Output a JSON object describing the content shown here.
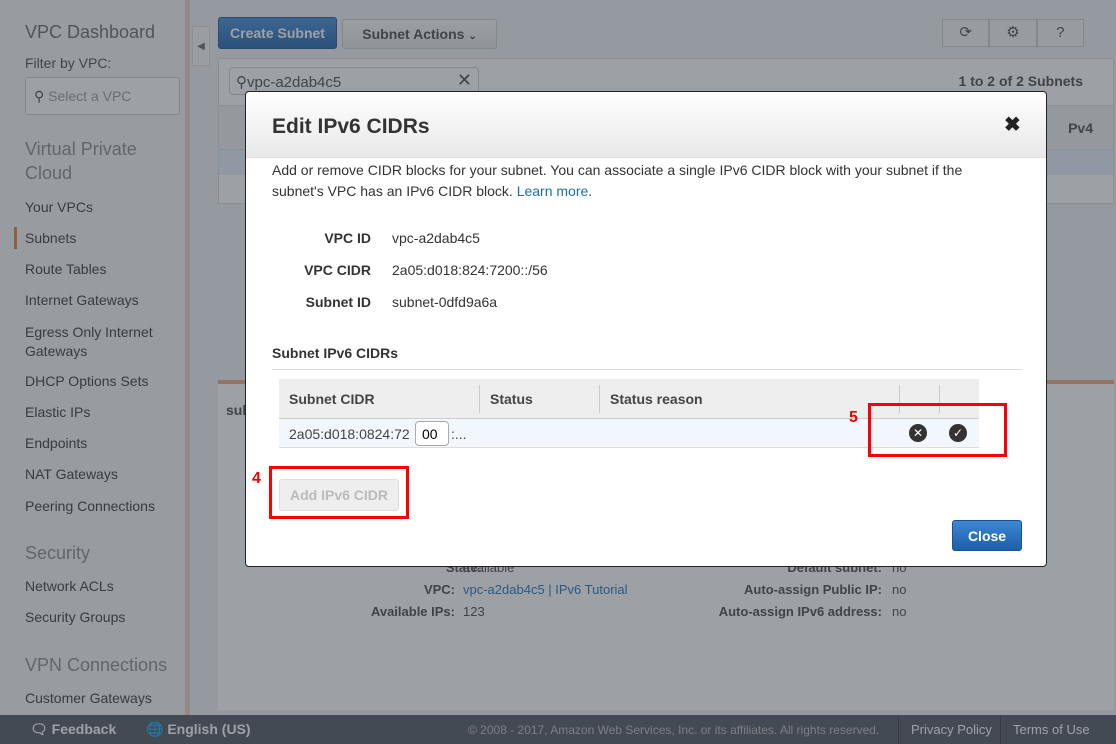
{
  "sidebar": {
    "title": "VPC Dashboard",
    "filter_label": "Filter by VPC:",
    "filter_placeholder": "Select a VPC",
    "sections": [
      {
        "title": "Virtual Private Cloud",
        "items": [
          "Your VPCs",
          "Subnets",
          "Route Tables",
          "Internet Gateways",
          "Egress Only Internet Gateways",
          "DHCP Options Sets",
          "Elastic IPs",
          "Endpoints",
          "NAT Gateways",
          "Peering Connections"
        ]
      },
      {
        "title": "Security",
        "items": [
          "Network ACLs",
          "Security Groups"
        ]
      },
      {
        "title": "VPN Connections",
        "items": [
          "Customer Gateways"
        ]
      }
    ],
    "active": "Subnets"
  },
  "toolbar": {
    "create": "Create Subnet",
    "actions": "Subnet Actions"
  },
  "search": {
    "value": "vpc-a2dab4c5"
  },
  "pagination": "1 to 2 of 2 Subnets",
  "table": {
    "partial_header": "Pv4"
  },
  "details": {
    "tab_partial": "sul",
    "rows": [
      [
        "State:",
        "available"
      ],
      [
        "VPC:",
        "vpc-a2dab4c5 | IPv6 Tutorial"
      ],
      [
        "Available IPs:",
        "123"
      ]
    ],
    "rows_right": [
      [
        "Default subnet:",
        "no"
      ],
      [
        "Auto-assign Public IP:",
        "no"
      ],
      [
        "Auto-assign IPv6 address:",
        "no"
      ]
    ]
  },
  "modal": {
    "title": "Edit IPv6 CIDRs",
    "desc": "Add or remove CIDR blocks for your subnet. You can associate a single IPv6 CIDR block with your subnet if the subnet's VPC has an IPv6 CIDR block.",
    "learn_more": "Learn more",
    "fields": [
      {
        "label": "VPC ID",
        "value": "vpc-a2dab4c5"
      },
      {
        "label": "VPC CIDR",
        "value": "2a05:d018:824:7200::/56"
      },
      {
        "label": "Subnet ID",
        "value": "subnet-0dfd9a6a"
      }
    ],
    "section": "Subnet IPv6 CIDRs",
    "columns": [
      "Subnet CIDR",
      "Status",
      "Status reason"
    ],
    "row": {
      "prefix": "2a05:d018:0824:72",
      "input": "00",
      "suffix": ":..."
    },
    "add_button": "Add IPv6 CIDR",
    "close_button": "Close"
  },
  "annotations": {
    "a4": "4",
    "a5": "5"
  },
  "footer": {
    "feedback": "Feedback",
    "language": "English (US)",
    "copyright": "© 2008 - 2017, Amazon Web Services, Inc. or its affiliates. All rights reserved.",
    "privacy": "Privacy Policy",
    "terms": "Terms of Use"
  }
}
